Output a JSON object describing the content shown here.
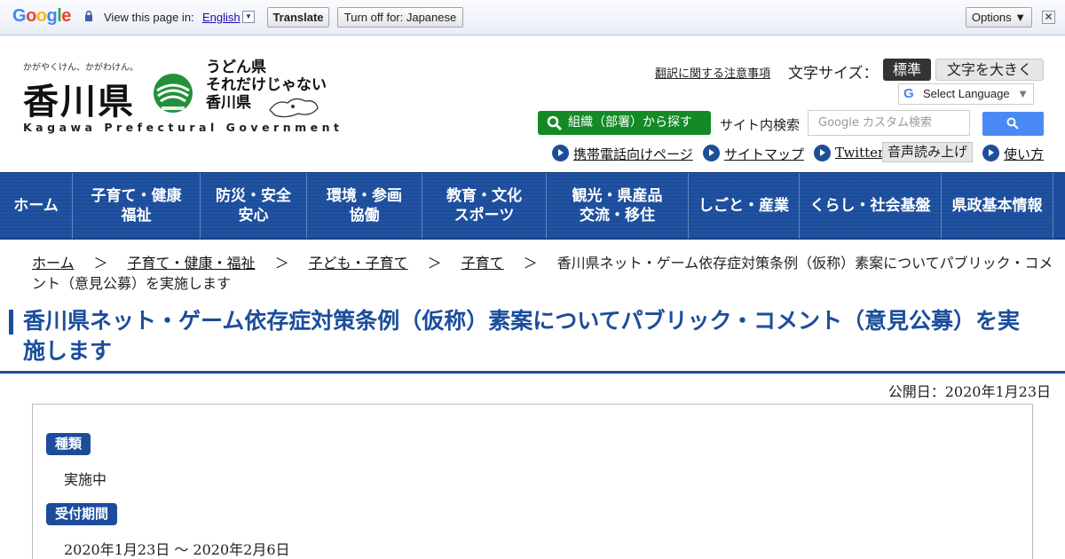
{
  "translate_bar": {
    "logo": "Google",
    "view_text": "View this page in:",
    "language": "English",
    "translate_button": "Translate",
    "turn_off_button": "Turn off for: Japanese",
    "options_button": "Options ▼",
    "close": "✕"
  },
  "header": {
    "tagline": "かがやくけん、かがわけん。",
    "logo_text": "香川県",
    "slogan_lines": [
      "うどん県",
      "それだけじゃない",
      "香川県"
    ],
    "logo_en": "Kagawa Prefectural Government",
    "notice_link": "翻訳に関する注意事項",
    "font_size_label": "文字サイズ：",
    "font_std": "標準",
    "font_big": "文字を大きく",
    "select_language": "Select Language",
    "org_search": "組織（部署）から探す",
    "site_search_label": "サイト内検索",
    "search_placeholder": "Google カスタム検索",
    "util_links": {
      "mobile": "携帯電話向けページ",
      "sitemap": "サイトマップ",
      "twitter": "Twitter",
      "voice": "音声読み上げ",
      "howto": "使い方"
    }
  },
  "nav": [
    "ホーム",
    "子育て・健康\n福祉",
    "防災・安全\n安心",
    "環境・参画\n協働",
    "教育・文化\nスポーツ",
    "観光・県産品\n交流・移住",
    "しごと・産業",
    "くらし・社会基盤",
    "県政基本情報"
  ],
  "breadcrumb": {
    "items": [
      "ホーム",
      "子育て・健康・福祉",
      "子ども・子育て",
      "子育て"
    ],
    "separator": "＞",
    "current": "香川県ネット・ゲーム依存症対策条例（仮称）素案についてパブリック・コメント（意見公募）を実施します"
  },
  "page": {
    "title": "香川県ネット・ゲーム依存症対策条例（仮称）素案についてパブリック・コメント（意見公募）を実施します",
    "published": "公開日：2020年1月23日",
    "sections": [
      {
        "label": "種類",
        "value": "実施中"
      },
      {
        "label": "受付期間",
        "value": "2020年1月23日 ～ 2020年2月6日"
      }
    ]
  },
  "colors": {
    "nav_blue": "#1b4d9c",
    "org_green": "#138a26",
    "search_blue": "#4a8af4"
  }
}
